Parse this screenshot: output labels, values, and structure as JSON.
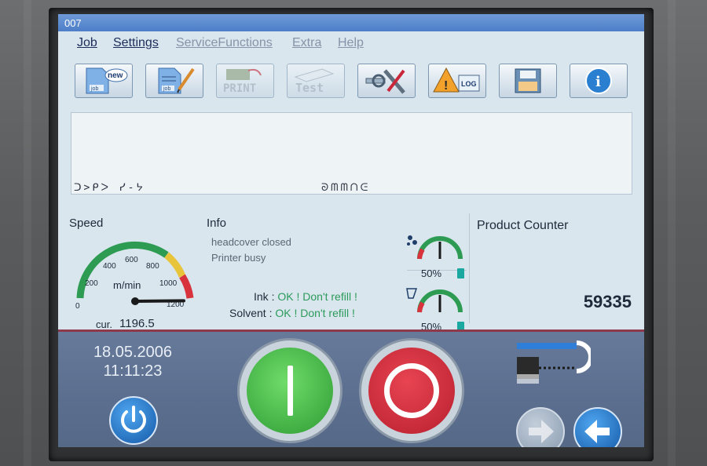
{
  "window": {
    "title": "007"
  },
  "menu": [
    {
      "label": "Job",
      "enabled": true
    },
    {
      "label": "Settings",
      "enabled": true
    },
    {
      "label": "ServiceFunctions",
      "enabled": false
    },
    {
      "label": "Extra",
      "enabled": false
    },
    {
      "label": "Help",
      "enabled": false
    }
  ],
  "toolbar": {
    "new_job": {
      "icon": "new-job-icon",
      "label": "new",
      "sublabel": "job"
    },
    "edit_job": {
      "icon": "edit-job-icon",
      "sublabel": "job"
    },
    "print": {
      "icon": "print-icon",
      "label": "PRINT"
    },
    "test": {
      "icon": "test-icon",
      "label": "Test"
    },
    "service": {
      "icon": "service-tools-icon"
    },
    "log": {
      "icon": "warning-log-icon",
      "label": "LOG"
    },
    "save": {
      "icon": "save-disk-icon"
    },
    "info": {
      "icon": "info-icon",
      "label": "i"
    }
  },
  "preview": {
    "text_left": "ᑐ>ᑭᐳ ᓯ-ᔭ",
    "text_right": "ᘐᗰᗰᑎᕮ"
  },
  "speed": {
    "heading": "Speed",
    "unit": "m/min",
    "ticks": [
      "0",
      "200",
      "400",
      "600",
      "800",
      "1000",
      "1200"
    ],
    "current_label": "cur.",
    "current_value": "1196.5",
    "value": 1196.5,
    "max": 1200
  },
  "info": {
    "heading": "Info",
    "lines": [
      "headcover closed",
      "Printer busy"
    ],
    "ink_label": "Ink :",
    "ink_status": "OK ! Don't refill !",
    "solvent_label": "Solvent :",
    "solvent_status": "OK ! Don't refill !"
  },
  "gauges": {
    "ink": {
      "percent_label": "50%",
      "level": 0.5
    },
    "solvent": {
      "percent_label": "50%",
      "level": 0.5
    }
  },
  "counter": {
    "heading": "Product Counter",
    "value": "59335"
  },
  "datetime": {
    "date": "18.05.2006",
    "time": "11:11:23"
  },
  "colors": {
    "start_green": "#3fb84a",
    "stop_red": "#c8283a",
    "gauge_green": "#2d9b52",
    "gauge_red": "#d8323c",
    "accent_blue": "#1f76c8"
  }
}
